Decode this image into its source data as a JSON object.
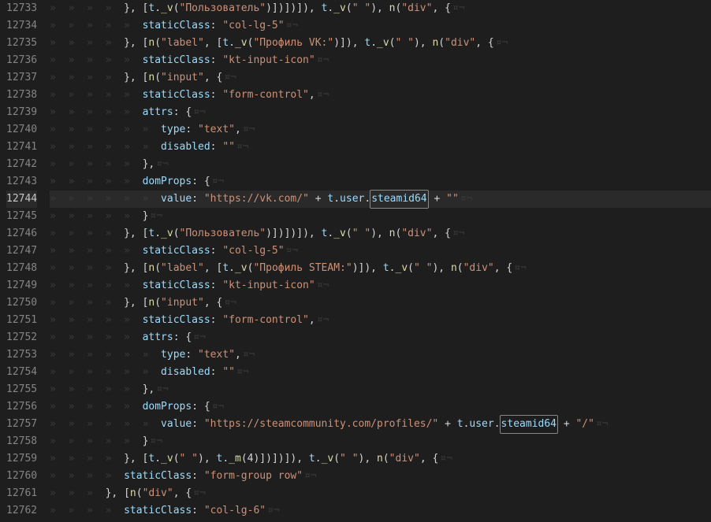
{
  "startLine": 12733,
  "currentLine": 12744,
  "whitespace": {
    "arrow": "»  ",
    "eol": "¤¬"
  },
  "lines": [
    {
      "indent": 4,
      "tokens": [
        {
          "t": "punc",
          "v": "}, ["
        },
        {
          "t": "var",
          "v": "t"
        },
        {
          "t": "punc",
          "v": "."
        },
        {
          "t": "fn",
          "v": "_v"
        },
        {
          "t": "punc",
          "v": "("
        },
        {
          "t": "str",
          "v": "\"Пользователь\""
        },
        {
          "t": "punc",
          "v": ")])])]), "
        },
        {
          "t": "var",
          "v": "t"
        },
        {
          "t": "punc",
          "v": "."
        },
        {
          "t": "fn",
          "v": "_v"
        },
        {
          "t": "punc",
          "v": "("
        },
        {
          "t": "str",
          "v": "\" \""
        },
        {
          "t": "punc",
          "v": "), "
        },
        {
          "t": "fn",
          "v": "n"
        },
        {
          "t": "punc",
          "v": "("
        },
        {
          "t": "str",
          "v": "\"div\""
        },
        {
          "t": "punc",
          "v": ", {"
        }
      ]
    },
    {
      "indent": 5,
      "tokens": [
        {
          "t": "prop",
          "v": "staticClass"
        },
        {
          "t": "punc",
          "v": ": "
        },
        {
          "t": "str",
          "v": "\"col-lg-5\""
        }
      ]
    },
    {
      "indent": 4,
      "tokens": [
        {
          "t": "punc",
          "v": "}, ["
        },
        {
          "t": "fn",
          "v": "n"
        },
        {
          "t": "punc",
          "v": "("
        },
        {
          "t": "str",
          "v": "\"label\""
        },
        {
          "t": "punc",
          "v": ", ["
        },
        {
          "t": "var",
          "v": "t"
        },
        {
          "t": "punc",
          "v": "."
        },
        {
          "t": "fn",
          "v": "_v"
        },
        {
          "t": "punc",
          "v": "("
        },
        {
          "t": "str",
          "v": "\"Профиль VK:\""
        },
        {
          "t": "punc",
          "v": ")]), "
        },
        {
          "t": "var",
          "v": "t"
        },
        {
          "t": "punc",
          "v": "."
        },
        {
          "t": "fn",
          "v": "_v"
        },
        {
          "t": "punc",
          "v": "("
        },
        {
          "t": "str",
          "v": "\" \""
        },
        {
          "t": "punc",
          "v": "), "
        },
        {
          "t": "fn",
          "v": "n"
        },
        {
          "t": "punc",
          "v": "("
        },
        {
          "t": "str",
          "v": "\"div\""
        },
        {
          "t": "punc",
          "v": ", {"
        }
      ]
    },
    {
      "indent": 5,
      "tokens": [
        {
          "t": "prop",
          "v": "staticClass"
        },
        {
          "t": "punc",
          "v": ": "
        },
        {
          "t": "str",
          "v": "\"kt-input-icon\""
        }
      ]
    },
    {
      "indent": 4,
      "tokens": [
        {
          "t": "punc",
          "v": "}, ["
        },
        {
          "t": "fn",
          "v": "n"
        },
        {
          "t": "punc",
          "v": "("
        },
        {
          "t": "str",
          "v": "\"input\""
        },
        {
          "t": "punc",
          "v": ", {"
        }
      ]
    },
    {
      "indent": 5,
      "tokens": [
        {
          "t": "prop",
          "v": "staticClass"
        },
        {
          "t": "punc",
          "v": ": "
        },
        {
          "t": "str",
          "v": "\"form-control\""
        },
        {
          "t": "punc",
          "v": ","
        }
      ]
    },
    {
      "indent": 5,
      "tokens": [
        {
          "t": "prop",
          "v": "attrs"
        },
        {
          "t": "punc",
          "v": ": {"
        }
      ]
    },
    {
      "indent": 6,
      "tokens": [
        {
          "t": "prop",
          "v": "type"
        },
        {
          "t": "punc",
          "v": ": "
        },
        {
          "t": "str",
          "v": "\"text\""
        },
        {
          "t": "punc",
          "v": ","
        }
      ]
    },
    {
      "indent": 6,
      "tokens": [
        {
          "t": "prop",
          "v": "disabled"
        },
        {
          "t": "punc",
          "v": ": "
        },
        {
          "t": "str",
          "v": "\"\""
        }
      ]
    },
    {
      "indent": 5,
      "tokens": [
        {
          "t": "punc",
          "v": "},"
        }
      ]
    },
    {
      "indent": 5,
      "tokens": [
        {
          "t": "prop",
          "v": "domProps"
        },
        {
          "t": "punc",
          "v": ": {"
        }
      ]
    },
    {
      "indent": 6,
      "tokens": [
        {
          "t": "prop",
          "v": "value"
        },
        {
          "t": "punc",
          "v": ": "
        },
        {
          "t": "str",
          "v": "\"https://vk.com/\""
        },
        {
          "t": "punc",
          "v": " + "
        },
        {
          "t": "var",
          "v": "t"
        },
        {
          "t": "punc",
          "v": "."
        },
        {
          "t": "var",
          "v": "user"
        },
        {
          "t": "punc",
          "v": "."
        },
        {
          "t": "var",
          "v": "steamid64",
          "hl": true
        },
        {
          "t": "punc",
          "v": " + "
        },
        {
          "t": "str",
          "v": "\"\""
        }
      ]
    },
    {
      "indent": 5,
      "tokens": [
        {
          "t": "punc",
          "v": "}"
        }
      ]
    },
    {
      "indent": 4,
      "tokens": [
        {
          "t": "punc",
          "v": "}, ["
        },
        {
          "t": "var",
          "v": "t"
        },
        {
          "t": "punc",
          "v": "."
        },
        {
          "t": "fn",
          "v": "_v"
        },
        {
          "t": "punc",
          "v": "("
        },
        {
          "t": "str",
          "v": "\"Пользователь\""
        },
        {
          "t": "punc",
          "v": ")])])]), "
        },
        {
          "t": "var",
          "v": "t"
        },
        {
          "t": "punc",
          "v": "."
        },
        {
          "t": "fn",
          "v": "_v"
        },
        {
          "t": "punc",
          "v": "("
        },
        {
          "t": "str",
          "v": "\" \""
        },
        {
          "t": "punc",
          "v": "), "
        },
        {
          "t": "fn",
          "v": "n"
        },
        {
          "t": "punc",
          "v": "("
        },
        {
          "t": "str",
          "v": "\"div\""
        },
        {
          "t": "punc",
          "v": ", {"
        }
      ]
    },
    {
      "indent": 5,
      "tokens": [
        {
          "t": "prop",
          "v": "staticClass"
        },
        {
          "t": "punc",
          "v": ": "
        },
        {
          "t": "str",
          "v": "\"col-lg-5\""
        }
      ]
    },
    {
      "indent": 4,
      "tokens": [
        {
          "t": "punc",
          "v": "}, ["
        },
        {
          "t": "fn",
          "v": "n"
        },
        {
          "t": "punc",
          "v": "("
        },
        {
          "t": "str",
          "v": "\"label\""
        },
        {
          "t": "punc",
          "v": ", ["
        },
        {
          "t": "var",
          "v": "t"
        },
        {
          "t": "punc",
          "v": "."
        },
        {
          "t": "fn",
          "v": "_v"
        },
        {
          "t": "punc",
          "v": "("
        },
        {
          "t": "str",
          "v": "\"Профиль STEAM:\""
        },
        {
          "t": "punc",
          "v": ")]), "
        },
        {
          "t": "var",
          "v": "t"
        },
        {
          "t": "punc",
          "v": "."
        },
        {
          "t": "fn",
          "v": "_v"
        },
        {
          "t": "punc",
          "v": "("
        },
        {
          "t": "str",
          "v": "\" \""
        },
        {
          "t": "punc",
          "v": "), "
        },
        {
          "t": "fn",
          "v": "n"
        },
        {
          "t": "punc",
          "v": "("
        },
        {
          "t": "str",
          "v": "\"div\""
        },
        {
          "t": "punc",
          "v": ", {"
        }
      ]
    },
    {
      "indent": 5,
      "tokens": [
        {
          "t": "prop",
          "v": "staticClass"
        },
        {
          "t": "punc",
          "v": ": "
        },
        {
          "t": "str",
          "v": "\"kt-input-icon\""
        }
      ]
    },
    {
      "indent": 4,
      "tokens": [
        {
          "t": "punc",
          "v": "}, ["
        },
        {
          "t": "fn",
          "v": "n"
        },
        {
          "t": "punc",
          "v": "("
        },
        {
          "t": "str",
          "v": "\"input\""
        },
        {
          "t": "punc",
          "v": ", {"
        }
      ]
    },
    {
      "indent": 5,
      "tokens": [
        {
          "t": "prop",
          "v": "staticClass"
        },
        {
          "t": "punc",
          "v": ": "
        },
        {
          "t": "str",
          "v": "\"form-control\""
        },
        {
          "t": "punc",
          "v": ","
        }
      ]
    },
    {
      "indent": 5,
      "tokens": [
        {
          "t": "prop",
          "v": "attrs"
        },
        {
          "t": "punc",
          "v": ": {"
        }
      ]
    },
    {
      "indent": 6,
      "tokens": [
        {
          "t": "prop",
          "v": "type"
        },
        {
          "t": "punc",
          "v": ": "
        },
        {
          "t": "str",
          "v": "\"text\""
        },
        {
          "t": "punc",
          "v": ","
        }
      ]
    },
    {
      "indent": 6,
      "tokens": [
        {
          "t": "prop",
          "v": "disabled"
        },
        {
          "t": "punc",
          "v": ": "
        },
        {
          "t": "str",
          "v": "\"\""
        }
      ]
    },
    {
      "indent": 5,
      "tokens": [
        {
          "t": "punc",
          "v": "},"
        }
      ]
    },
    {
      "indent": 5,
      "tokens": [
        {
          "t": "prop",
          "v": "domProps"
        },
        {
          "t": "punc",
          "v": ": {"
        }
      ]
    },
    {
      "indent": 6,
      "tokens": [
        {
          "t": "prop",
          "v": "value"
        },
        {
          "t": "punc",
          "v": ": "
        },
        {
          "t": "str",
          "v": "\"https://steamcommunity.com/profiles/\""
        },
        {
          "t": "punc",
          "v": " + "
        },
        {
          "t": "var",
          "v": "t"
        },
        {
          "t": "punc",
          "v": "."
        },
        {
          "t": "var",
          "v": "user"
        },
        {
          "t": "punc",
          "v": "."
        },
        {
          "t": "var",
          "v": "steamid64",
          "hl": true
        },
        {
          "t": "punc",
          "v": " + "
        },
        {
          "t": "str",
          "v": "\"/\""
        }
      ]
    },
    {
      "indent": 5,
      "tokens": [
        {
          "t": "punc",
          "v": "}"
        }
      ]
    },
    {
      "indent": 4,
      "tokens": [
        {
          "t": "punc",
          "v": "}, ["
        },
        {
          "t": "var",
          "v": "t"
        },
        {
          "t": "punc",
          "v": "."
        },
        {
          "t": "fn",
          "v": "_v"
        },
        {
          "t": "punc",
          "v": "("
        },
        {
          "t": "str",
          "v": "\" \""
        },
        {
          "t": "punc",
          "v": "), "
        },
        {
          "t": "var",
          "v": "t"
        },
        {
          "t": "punc",
          "v": "."
        },
        {
          "t": "fn",
          "v": "_m"
        },
        {
          "t": "punc",
          "v": "(4)])])]), "
        },
        {
          "t": "var",
          "v": "t"
        },
        {
          "t": "punc",
          "v": "."
        },
        {
          "t": "fn",
          "v": "_v"
        },
        {
          "t": "punc",
          "v": "("
        },
        {
          "t": "str",
          "v": "\" \""
        },
        {
          "t": "punc",
          "v": "), "
        },
        {
          "t": "fn",
          "v": "n"
        },
        {
          "t": "punc",
          "v": "("
        },
        {
          "t": "str",
          "v": "\"div\""
        },
        {
          "t": "punc",
          "v": ", {"
        }
      ]
    },
    {
      "indent": 4,
      "tokens": [
        {
          "t": "prop",
          "v": "staticClass"
        },
        {
          "t": "punc",
          "v": ": "
        },
        {
          "t": "str",
          "v": "\"form-group row\""
        }
      ]
    },
    {
      "indent": 3,
      "tokens": [
        {
          "t": "punc",
          "v": "}, ["
        },
        {
          "t": "fn",
          "v": "n"
        },
        {
          "t": "punc",
          "v": "("
        },
        {
          "t": "str",
          "v": "\"div\""
        },
        {
          "t": "punc",
          "v": ", {"
        }
      ]
    },
    {
      "indent": 4,
      "tokens": [
        {
          "t": "prop",
          "v": "staticClass"
        },
        {
          "t": "punc",
          "v": ": "
        },
        {
          "t": "str",
          "v": "\"col-lg-6\""
        }
      ]
    }
  ]
}
